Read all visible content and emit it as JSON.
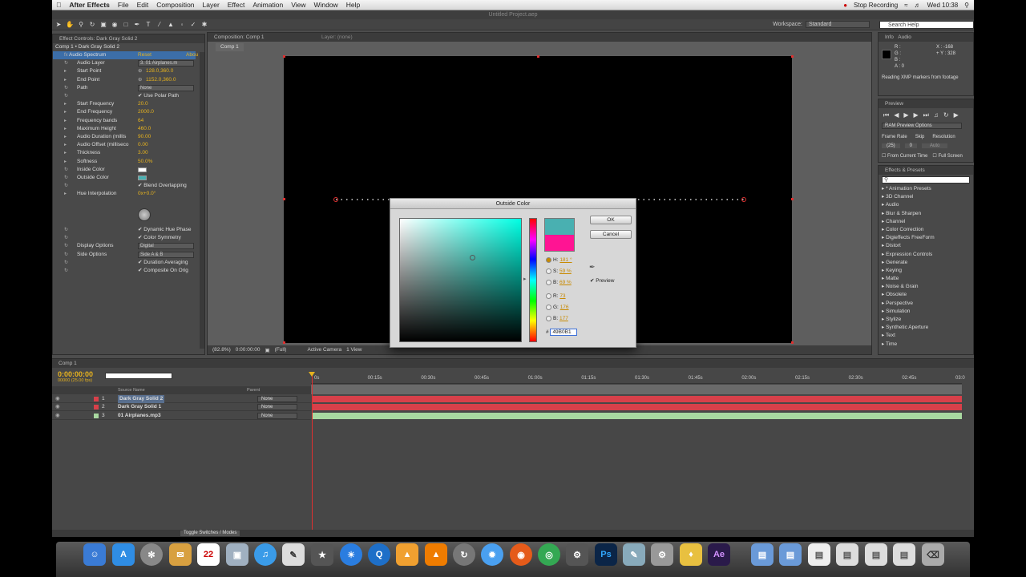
{
  "menubar": {
    "apple": "",
    "app": "After Effects",
    "items": [
      "File",
      "Edit",
      "Composition",
      "Layer",
      "Effect",
      "Animation",
      "View",
      "Window",
      "Help"
    ],
    "recording": "Stop Recording",
    "clock": "Wed 10:38"
  },
  "titlebar": "Untitled Project.aep",
  "toolbar": {
    "workspace_label": "Workspace:",
    "workspace_value": "Standard",
    "search_placeholder": "Search Help"
  },
  "effects_panel": {
    "tab": "Effect Controls: Dark Gray Solid 2",
    "breadcrumb": "Comp 1 • Dark Gray Solid 2",
    "effect_name": "Audio Spectrum",
    "reset": "Reset",
    "about": "Abou",
    "rows": [
      {
        "label": "Audio Layer",
        "value": "3. 01 Airplanes.m",
        "kind": "drop"
      },
      {
        "label": "Start Point",
        "value": "128.0,360.0",
        "kind": "point"
      },
      {
        "label": "End Point",
        "value": "1152.0,360.0",
        "kind": "point"
      },
      {
        "label": "Path",
        "value": "None",
        "kind": "drop"
      },
      {
        "label": "",
        "value": "Use Polar Path",
        "kind": "check"
      },
      {
        "label": "Start Frequency",
        "value": "20.0",
        "kind": "num"
      },
      {
        "label": "End Frequency",
        "value": "2000.0",
        "kind": "num"
      },
      {
        "label": "Frequency bands",
        "value": "64",
        "kind": "num"
      },
      {
        "label": "Maximum Height",
        "value": "460.0",
        "kind": "num"
      },
      {
        "label": "Audio Duration (millis",
        "value": "90.00",
        "kind": "num"
      },
      {
        "label": "Audio Offset (milliseco",
        "value": "0.00",
        "kind": "num"
      },
      {
        "label": "Thickness",
        "value": "3.00",
        "kind": "num"
      },
      {
        "label": "Softness",
        "value": "50.0%",
        "kind": "num"
      },
      {
        "label": "Inside Color",
        "value": "#ffffff",
        "kind": "color"
      },
      {
        "label": "Outside Color",
        "value": "#49b0b1",
        "kind": "color"
      },
      {
        "label": "",
        "value": "Blend Overlapping",
        "kind": "check"
      },
      {
        "label": "Hue Interpolation",
        "value": "0x+0.0°",
        "kind": "num"
      }
    ],
    "rows2": [
      {
        "label": "",
        "value": "Dynamic Hue Phase",
        "kind": "check"
      },
      {
        "label": "",
        "value": "Color Symmetry",
        "kind": "check"
      },
      {
        "label": "Display Options",
        "value": "Digital",
        "kind": "drop"
      },
      {
        "label": "Side Options",
        "value": "Side A & B",
        "kind": "drop"
      },
      {
        "label": "",
        "value": "Duration Averaging",
        "kind": "check"
      },
      {
        "label": "",
        "value": "Composite On Orig",
        "kind": "check"
      }
    ]
  },
  "comp_panel": {
    "tab": "Composition: Comp 1",
    "layer_tab": "Layer: (none)",
    "subtab": "Comp 1",
    "zoom": "(82.8%)",
    "time": "0:00:00:00",
    "quality": "(Full)",
    "camera": "Active Camera",
    "view": "1 View"
  },
  "dialog": {
    "title": "Outside Color",
    "ok": "OK",
    "cancel": "Cancel",
    "preview": "Preview",
    "new_color": "#49b0b1",
    "old_color": "#ff1493",
    "fields": [
      {
        "key": "H:",
        "value": "181 °"
      },
      {
        "key": "S:",
        "value": "59 %"
      },
      {
        "key": "B:",
        "value": "69 %"
      },
      {
        "key": "R:",
        "value": "73"
      },
      {
        "key": "G:",
        "value": "176"
      },
      {
        "key": "B:",
        "value": "177"
      }
    ],
    "hex_label": "#",
    "hex": "49B0B1"
  },
  "info_panel": {
    "tabs": [
      "Info",
      "Audio"
    ],
    "r": "R :",
    "g": "G :",
    "b": "B :",
    "a": "A : 0",
    "x": "X : -168",
    "y": "+ Y : 328",
    "message": "Reading XMP markers from footage"
  },
  "preview_panel": {
    "tab": "Preview",
    "options": "RAM Preview Options",
    "frame_rate_label": "Frame Rate",
    "skip_label": "Skip",
    "resolution_label": "Resolution",
    "frame_rate": "(25)",
    "skip": "0",
    "resolution": "Auto",
    "from_current": "From Current Time",
    "full_screen": "Full Screen"
  },
  "fx_presets": {
    "tab": "Effects & Presets",
    "items": [
      "* Animation Presets",
      "3D Channel",
      "Audio",
      "Blur & Sharpen",
      "Channel",
      "Color Correction",
      "Digieffects FreeForm",
      "Distort",
      "Expression Controls",
      "Generate",
      "Keying",
      "Matte",
      "Noise & Grain",
      "Obsolete",
      "Perspective",
      "Simulation",
      "Stylize",
      "Synthetic Aperture",
      "Text",
      "Time"
    ]
  },
  "timeline": {
    "tab": "Comp 1",
    "timecode": "0:00:00:00",
    "fps": "00000 (25.00 fps)",
    "source_header": "Source Name",
    "parent_header": "Parent",
    "layers": [
      {
        "num": "1",
        "name": "Dark Gray Solid 2",
        "parent": "None",
        "color": "#d8404a"
      },
      {
        "num": "2",
        "name": "Dark Gray Solid 1",
        "parent": "None",
        "color": "#d8404a"
      },
      {
        "num": "3",
        "name": "01 Airplanes.mp3",
        "parent": "None",
        "color": "#a8d8a0"
      }
    ],
    "ruler": [
      "0s",
      "00:15s",
      "00:30s",
      "00:45s",
      "01:00s",
      "01:15s",
      "01:30s",
      "01:45s",
      "02:00s",
      "02:15s",
      "02:30s",
      "02:45s",
      "03:0"
    ],
    "toggle": "Toggle Switches / Modes"
  },
  "dock": {
    "calendar": "22",
    "ps": "Ps",
    "ae": "Ae"
  }
}
